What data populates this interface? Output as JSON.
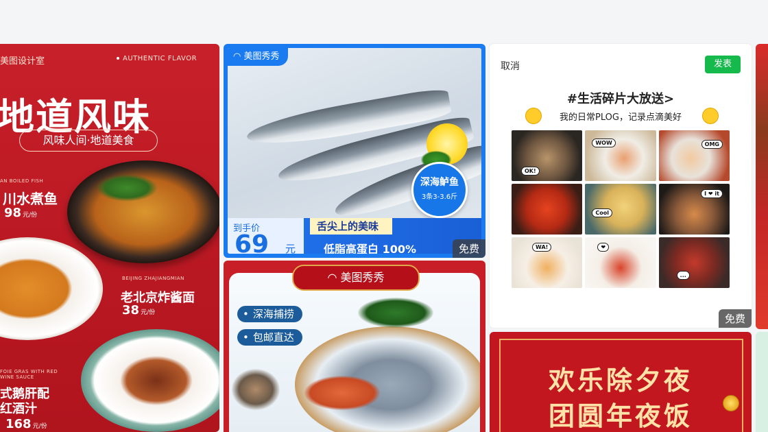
{
  "cards": {
    "menu": {
      "brand": "美图设计室",
      "authentic": "AUTHENTIC FLAVOR",
      "title": "地道风味",
      "subtitle": "风味人间·地道美食",
      "dishes": [
        {
          "en": "AN BOILED FISH",
          "name": "川水煮鱼",
          "price": "98",
          "unit": "元/份"
        },
        {
          "en": "BEIJING ZHAJIANGMIAN",
          "name": "老北京炸酱面",
          "price": "38",
          "unit": "元/份"
        },
        {
          "en": "FOIE GRAS WITH RED WINE SAUCE",
          "name": "式鹅肝配红酒汁",
          "price": "168",
          "unit": "元/份"
        }
      ]
    },
    "fish": {
      "logo": "美图秀秀",
      "tag_line1": "深海鲈鱼",
      "tag_line2": "3条3-3.6斤",
      "price_label": "到手价",
      "price": "69",
      "price_unit": "元",
      "slogan1": "舌尖上的美味",
      "slogan2": "低脂高蛋白 100%",
      "badge": "免费"
    },
    "post": {
      "cancel": "取消",
      "publish": "发表",
      "hashtag": "#生活碎片大放送>",
      "caption": "我的日常PLOG，记录点滴美好",
      "stickers": [
        "OK!",
        "WOW",
        "OMG",
        "Cool",
        "I ❤ it",
        "WA!",
        "❤",
        "..."
      ],
      "badge": "免费"
    },
    "seafood": {
      "logo": "美图秀秀",
      "chip1": "深海捕捞",
      "chip2": "包邮直达"
    },
    "newyear": {
      "line1": "欢乐除夕夜",
      "line2": "团圆年夜饭"
    }
  },
  "colors": {
    "menu_red": "#c8202a",
    "fish_blue": "#1a7bf0",
    "publish_green": "#16b94c",
    "newyear_gold": "#ffe2a8"
  }
}
